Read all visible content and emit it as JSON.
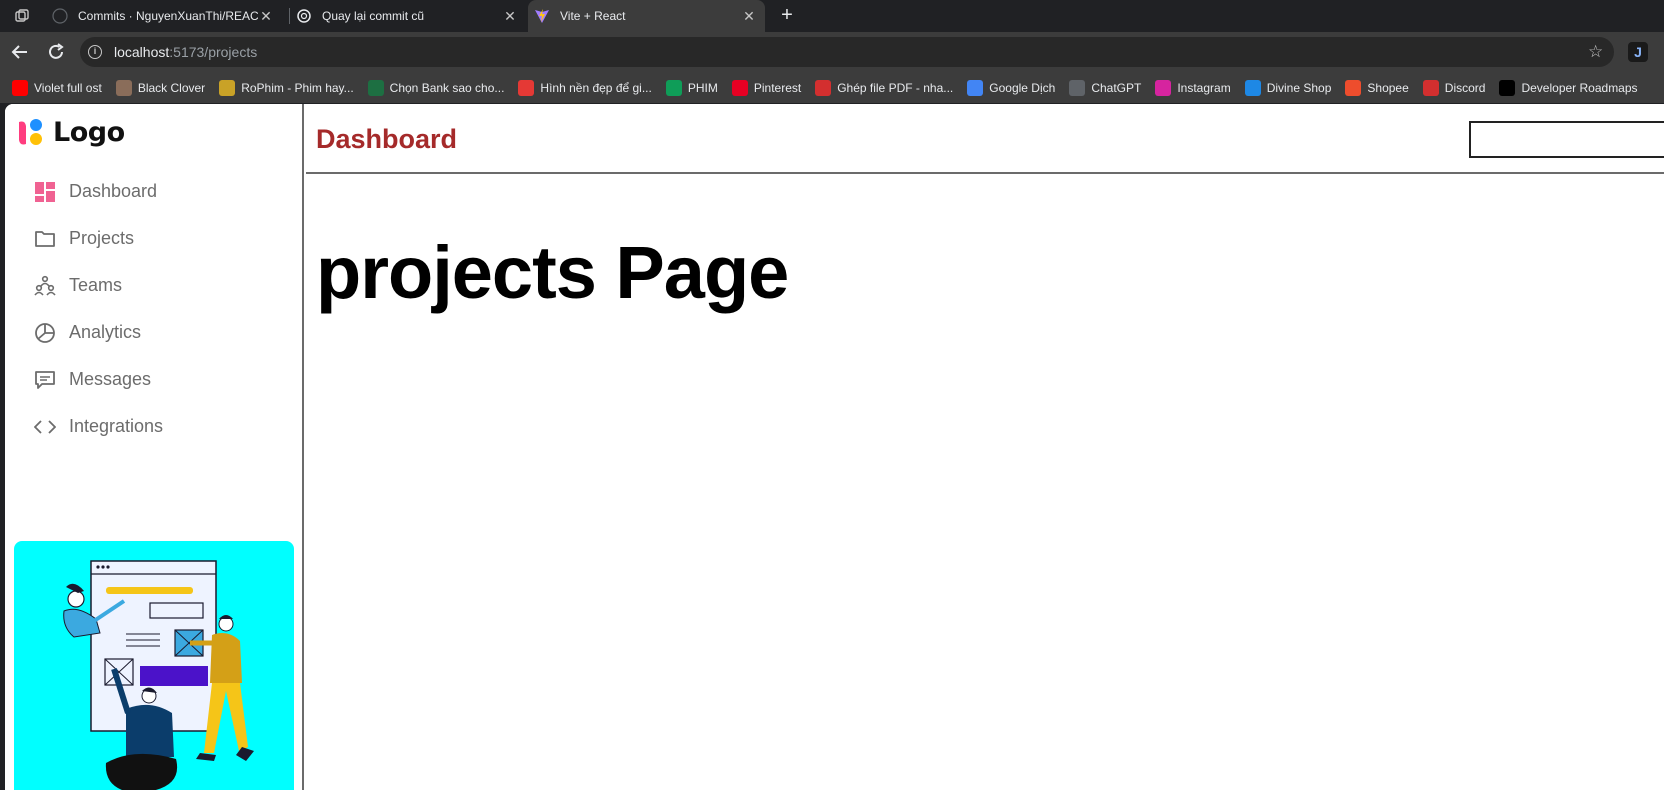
{
  "browser": {
    "tabs": [
      {
        "title": "Commits · NguyenXuanThi/REACT",
        "active": false
      },
      {
        "title": "Quay lại commit cũ",
        "active": false
      },
      {
        "title": "Vite + React",
        "active": true
      }
    ],
    "url_host": "localhost",
    "url_path": ":5173/projects",
    "bookmarks": [
      {
        "label": "Violet full ost",
        "icon": "youtube-icon",
        "color": "#ff0000"
      },
      {
        "label": "Black Clover",
        "icon": "anime-icon",
        "color": "#8a6d5a"
      },
      {
        "label": "RoPhim - Phim hay...",
        "icon": "rophim-icon",
        "color": "#c9a227"
      },
      {
        "label": "Chọn Bank sao cho...",
        "icon": "excel-icon",
        "color": "#1d6f42"
      },
      {
        "label": "Hình nền đẹp để gi...",
        "icon": "g-icon",
        "color": "#e53935"
      },
      {
        "label": "PHIM",
        "icon": "sheets-icon",
        "color": "#0f9d58"
      },
      {
        "label": "Pinterest",
        "icon": "pinterest-icon",
        "color": "#e60023"
      },
      {
        "label": "Ghép file PDF - nha...",
        "icon": "pdf-icon",
        "color": "#d32f2f"
      },
      {
        "label": "Google Dịch",
        "icon": "translate-icon",
        "color": "#4285f4"
      },
      {
        "label": "ChatGPT",
        "icon": "chatgpt-icon",
        "color": "#5f6368"
      },
      {
        "label": "Instagram",
        "icon": "instagram-icon",
        "color": "#d6249f"
      },
      {
        "label": "Divine Shop",
        "icon": "divine-icon",
        "color": "#1e88e5"
      },
      {
        "label": "Shopee",
        "icon": "shopee-icon",
        "color": "#ee4d2d"
      },
      {
        "label": "Discord",
        "icon": "discord-icon",
        "color": "#d32f2f"
      },
      {
        "label": "Developer Roadmaps",
        "icon": "roadmap-icon",
        "color": "#000000"
      }
    ]
  },
  "app": {
    "logo_text": "Logo",
    "sidebar": {
      "items": [
        {
          "label": "Dashboard",
          "icon": "dashboard-icon",
          "active": true
        },
        {
          "label": "Projects",
          "icon": "folder-icon"
        },
        {
          "label": "Teams",
          "icon": "teams-icon"
        },
        {
          "label": "Analytics",
          "icon": "pie-chart-icon"
        },
        {
          "label": "Messages",
          "icon": "message-icon"
        },
        {
          "label": "Integrations",
          "icon": "code-icon"
        }
      ]
    },
    "header": {
      "title": "Dashboard",
      "title_color": "#a52a2a"
    },
    "search": {
      "value": ""
    },
    "heading": "projects Page",
    "illustration_bg": "#00ffff"
  }
}
